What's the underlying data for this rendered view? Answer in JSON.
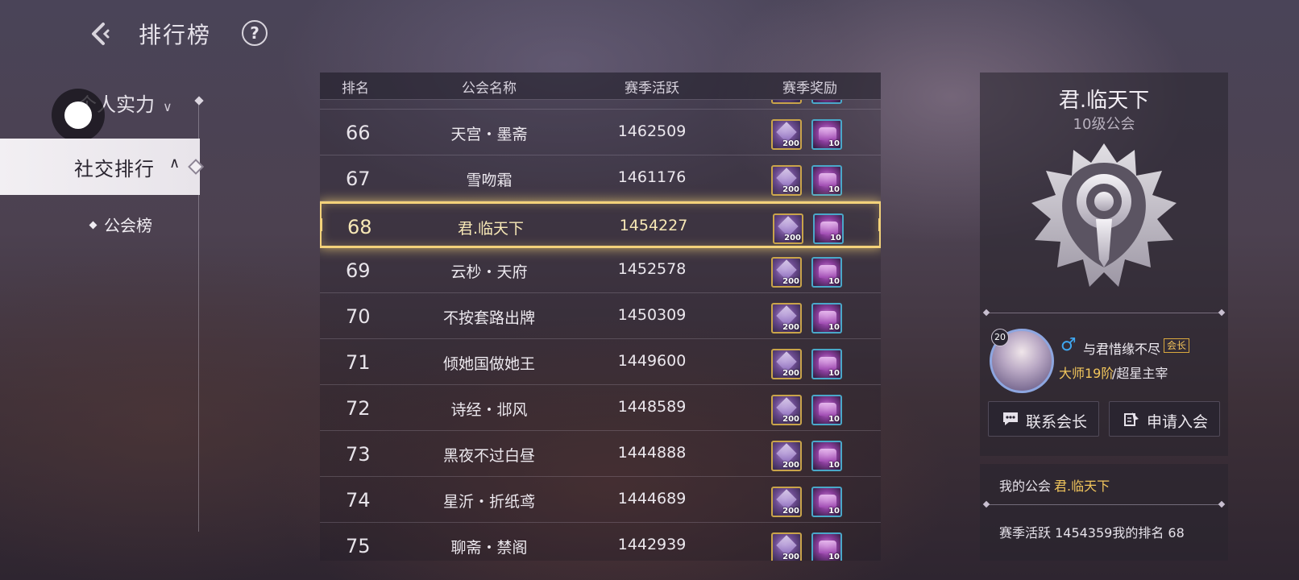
{
  "header": {
    "title": "排行榜"
  },
  "nav": {
    "personal_label": "个人实力",
    "social_label": "社交排行",
    "guild_label": "公会榜"
  },
  "table": {
    "columns": [
      "排名",
      "公会名称",
      "赛季活跃",
      "赛季奖励"
    ],
    "rows": [
      {
        "rank": "66",
        "name": "天宫・墨斋",
        "activity": "1462509",
        "reward1": "200",
        "reward2": "10"
      },
      {
        "rank": "67",
        "name": "雪吻霜",
        "activity": "1461176",
        "reward1": "200",
        "reward2": "10"
      },
      {
        "rank": "68",
        "name": "君.临天下",
        "activity": "1454227",
        "reward1": "200",
        "reward2": "10",
        "highlighted": true
      },
      {
        "rank": "69",
        "name": "云杪・天府",
        "activity": "1452578",
        "reward1": "200",
        "reward2": "10"
      },
      {
        "rank": "70",
        "name": "不按套路出牌",
        "activity": "1450309",
        "reward1": "200",
        "reward2": "10"
      },
      {
        "rank": "71",
        "name": "倾她国做她王",
        "activity": "1449600",
        "reward1": "200",
        "reward2": "10"
      },
      {
        "rank": "72",
        "name": "诗经・邶风",
        "activity": "1448589",
        "reward1": "200",
        "reward2": "10"
      },
      {
        "rank": "73",
        "name": "黑夜不过白昼",
        "activity": "1444888",
        "reward1": "200",
        "reward2": "10"
      },
      {
        "rank": "74",
        "name": "星沂・折纸鸢",
        "activity": "1444689",
        "reward1": "200",
        "reward2": "10"
      },
      {
        "rank": "75",
        "name": "聊斋・禁阁",
        "activity": "1442939",
        "reward1": "200",
        "reward2": "10"
      }
    ]
  },
  "guild_panel": {
    "name": "君.临天下",
    "level": "10级公会",
    "leader_level": "20",
    "leader_name": "与君惜缘不尽",
    "leader_badge": "会长",
    "leader_rank_gold": "大师19阶",
    "leader_rank_tier": "/超星主宰",
    "contact_label": "联系会长",
    "apply_label": "申请入会"
  },
  "my_guild": {
    "label": "我的公会",
    "value": "君.临天下",
    "stats": "赛季活跃 1454359我的排名 68"
  },
  "colors": {
    "highlight": "#f3d27a",
    "gold_text": "#f1c55c",
    "male_blue": "#3fa7f0"
  }
}
